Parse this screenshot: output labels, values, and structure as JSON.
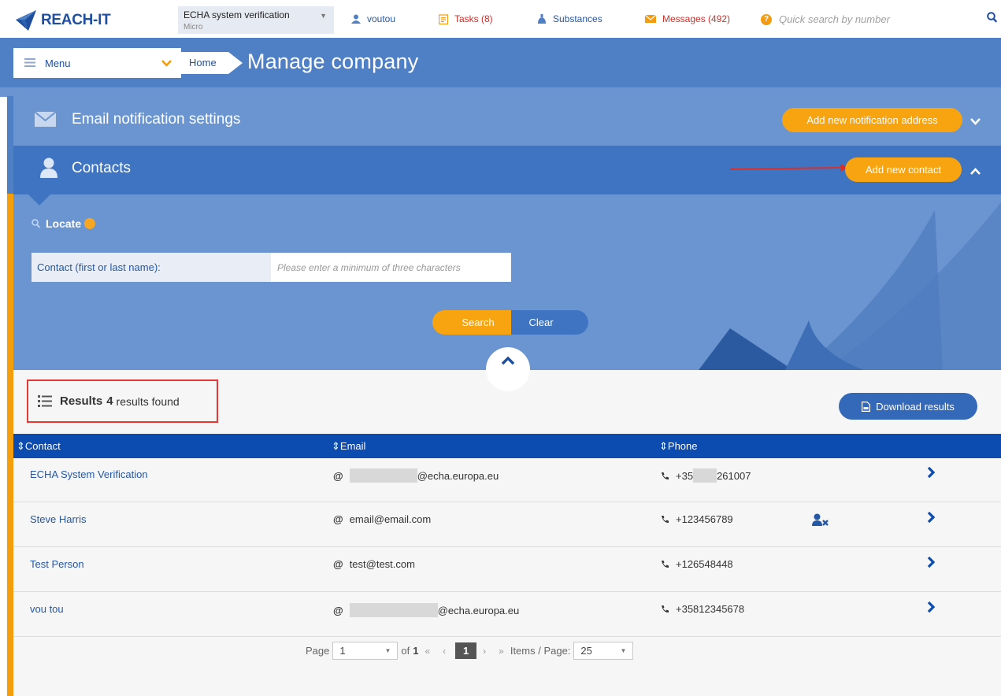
{
  "app": {
    "name": "REACH-IT"
  },
  "topbar": {
    "company_name": "ECHA system verification",
    "company_size": "Micro",
    "user": "voutou",
    "tasks": "Tasks (8)",
    "substances": "Substances",
    "messages": "Messages (492)",
    "quick_search_placeholder": "Quick search by number"
  },
  "header": {
    "menu_label": "Menu",
    "breadcrumb_home": "Home",
    "title": "Manage company"
  },
  "panels": {
    "email": {
      "title": "Email notification settings",
      "add_button": "Add new notification address"
    },
    "contacts": {
      "title": "Contacts",
      "add_button": "Add new contact"
    }
  },
  "locate": {
    "title": "Locate",
    "field_label": "Contact (first or last name):",
    "field_placeholder": "Please enter a minimum of three characters",
    "search_button": "Search",
    "clear_button": "Clear"
  },
  "results": {
    "label": "Results",
    "count": "4",
    "found_text": "results found",
    "download_button": "Download results",
    "columns": [
      "Contact",
      "Email",
      "Phone"
    ],
    "rows": [
      {
        "contact": "ECHA System Verification",
        "email": "@echa.europa.eu",
        "phone_prefix": "+35",
        "phone": "261007"
      },
      {
        "contact": "Steve Harris",
        "email": "email@email.com",
        "phone": "+123456789"
      },
      {
        "contact": "Test Person",
        "email": "test@test.com",
        "phone": "+126548448"
      },
      {
        "contact": "vou tou",
        "email": "@echa.europa.eu",
        "phone": "+35812345678"
      }
    ]
  },
  "pager": {
    "page_label": "Page",
    "page": "1",
    "of_label": "of",
    "total": "1",
    "current": "1",
    "items_label": "Items / Page:",
    "items_per_page": "25"
  },
  "colors": {
    "brand_blue": "#1f4e9e",
    "header_blue": "#4f7fc4",
    "panel_light": "#6a95d1",
    "panel_dark": "#3e74c2",
    "table_head": "#0c4bb0",
    "accent_orange": "#f8a310",
    "alert_red": "#c9322d"
  },
  "icons": {
    "logo": "reach-it-logo",
    "user": "user-icon",
    "tasks": "tasks-icon",
    "substances": "flask-icon",
    "messages": "envelope-icon",
    "help": "help-icon",
    "search": "search-icon",
    "menu": "hamburger-icon",
    "list": "list-icon",
    "download": "document-icon",
    "phone": "phone-icon",
    "remove_user": "user-remove-icon",
    "go": "chevron-right-icon"
  }
}
